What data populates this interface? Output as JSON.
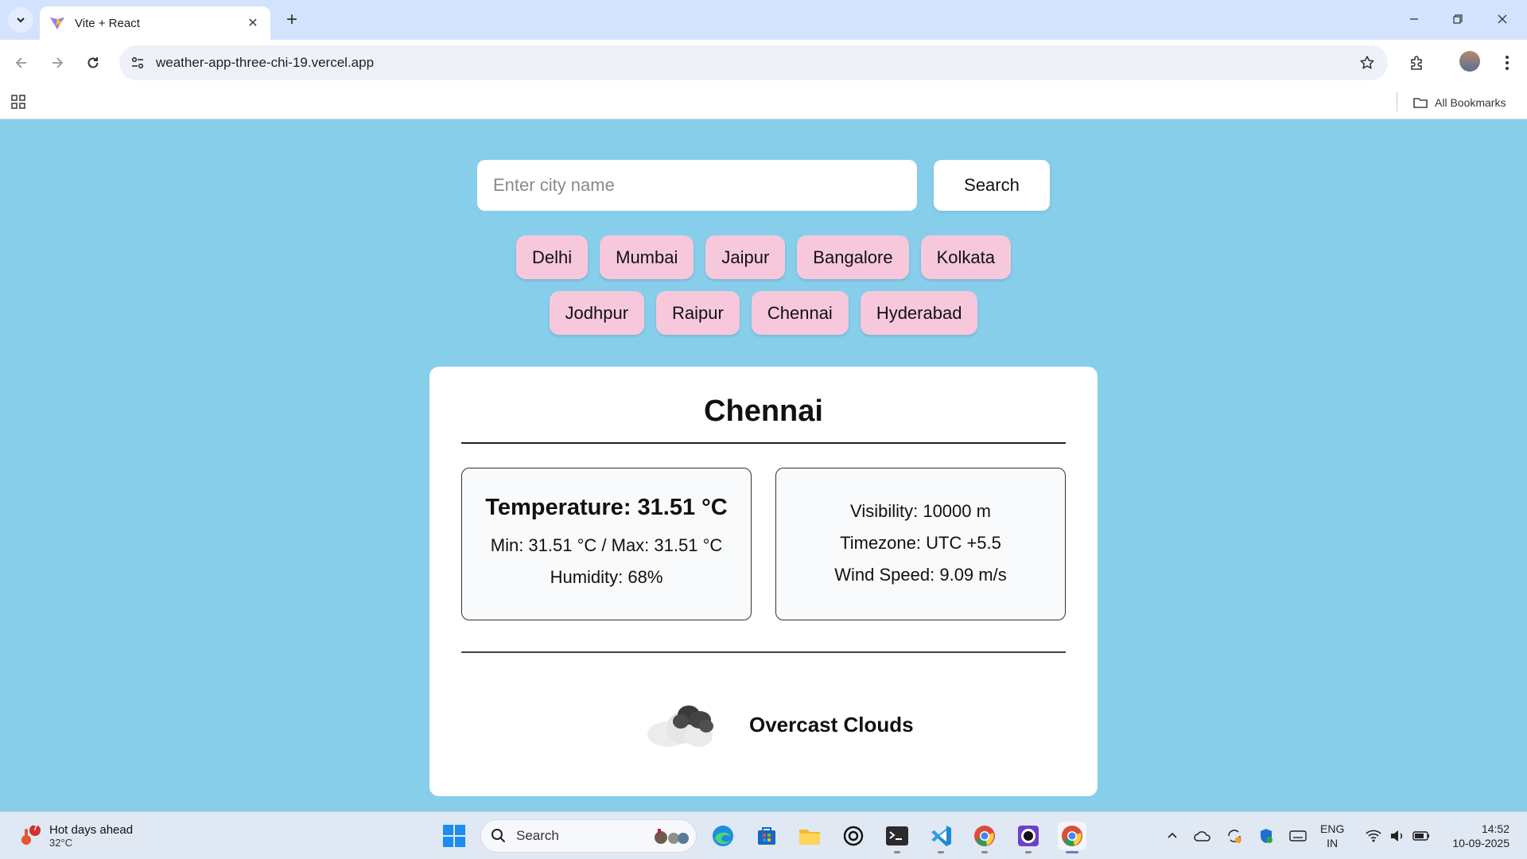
{
  "browser": {
    "tab_title": "Vite + React",
    "url": "weather-app-three-chi-19.vercel.app",
    "bookmarks_label": "All Bookmarks"
  },
  "search": {
    "placeholder": "Enter city name",
    "button_label": "Search"
  },
  "cities": {
    "row1": [
      "Delhi",
      "Mumbai",
      "Jaipur",
      "Bangalore",
      "Kolkata"
    ],
    "row2": [
      "Jodhpur",
      "Raipur",
      "Chennai",
      "Hyderabad"
    ]
  },
  "weather": {
    "city": "Chennai",
    "temperature": "Temperature: 31.51 °C",
    "min_max": "Min: 31.51 °C / Max: 31.51 °C",
    "humidity": "Humidity: 68%",
    "visibility": "Visibility: 10000 m",
    "timezone": "Timezone: UTC +5.5",
    "wind_speed": "Wind Speed: 9.09 m/s",
    "condition": "Overcast Clouds",
    "condition_icon": "overcast-clouds-icon"
  },
  "taskbar": {
    "weather_title": "Hot days ahead",
    "weather_temp": "32°C",
    "weather_badge": "7",
    "search_label": "Search",
    "lang_1": "ENG",
    "lang_2": "IN",
    "time": "14:52",
    "date": "10-09-2025"
  },
  "colors": {
    "page_background": "#87ceeb",
    "chip_background": "#f7c8dc",
    "card_background": "#ffffff"
  }
}
